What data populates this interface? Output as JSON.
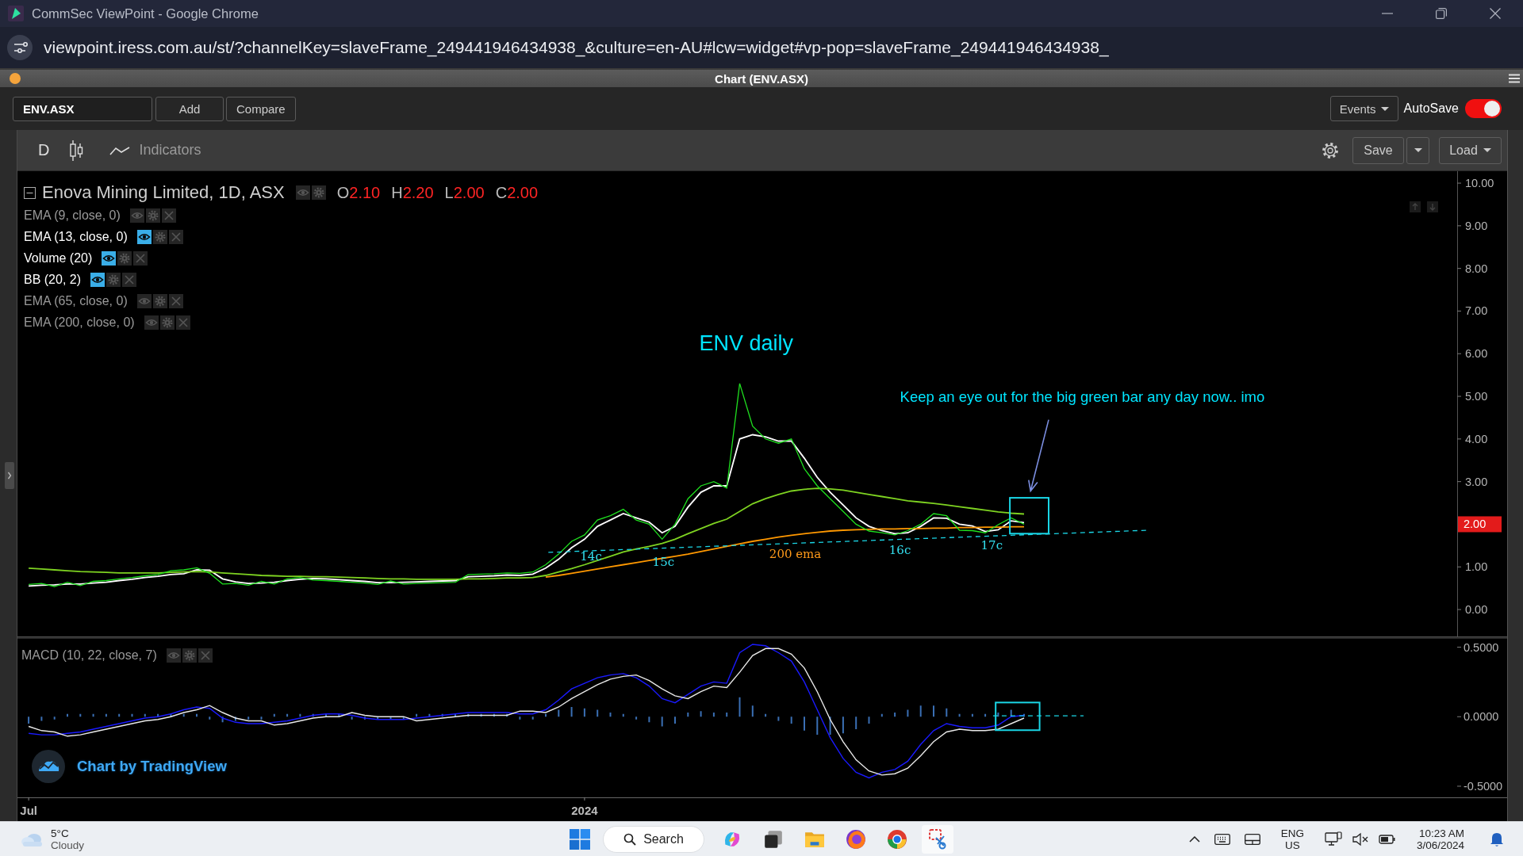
{
  "browser": {
    "title": "CommSec ViewPoint - Google Chrome",
    "url": "viewpoint.iress.com.au/st/?channelKey=slaveFrame_249441946434938_&culture=en-AU#lcw=widget#vp-pop=slaveFrame_249441946434938_"
  },
  "widget": {
    "title": "Chart (ENV.ASX)"
  },
  "toolbar": {
    "symbol": "ENV.ASX",
    "buttons": [
      "Add",
      "Compare"
    ],
    "events": "Events",
    "autosave": {
      "label": "AutoSave",
      "on": true
    }
  },
  "chart_toolbar": {
    "interval": "D",
    "indicators": "Indicators",
    "save": "Save",
    "load": "Load"
  },
  "legend": {
    "title": "Enova Mining Limited, 1D, ASX",
    "ohlc": [
      {
        "label": "O",
        "value": "2.10"
      },
      {
        "label": "H",
        "value": "2.20"
      },
      {
        "label": "L",
        "value": "2.00"
      },
      {
        "label": "C",
        "value": "2.00"
      }
    ],
    "indicators": [
      {
        "name": "EMA (9, close, 0)",
        "hidden": false
      },
      {
        "name": "EMA (13, close, 0)",
        "hidden": true
      },
      {
        "name": "Volume (20)",
        "hidden": true
      },
      {
        "name": "BB (20, 2)",
        "hidden": true
      },
      {
        "name": "EMA (65, close, 0)",
        "hidden": false
      },
      {
        "name": "EMA (200, close, 0)",
        "hidden": false
      }
    ]
  },
  "price_pane": {
    "last_price": "2.00",
    "chart_data": {
      "type": "line",
      "title": "ENV daily",
      "categories": [
        null,
        null,
        null,
        null,
        null,
        null,
        null,
        null,
        null,
        null,
        null,
        null,
        null,
        null,
        null,
        null,
        null,
        null,
        null,
        null,
        null,
        null,
        null,
        null,
        null,
        null,
        null,
        null,
        null,
        null,
        null,
        null,
        null,
        null,
        null,
        null,
        null,
        null,
        null,
        null,
        null,
        null,
        null,
        null,
        null,
        null,
        null,
        null,
        null,
        null,
        null,
        null,
        null,
        null,
        null,
        null,
        null,
        null,
        null,
        null,
        null,
        null,
        null,
        null,
        null,
        null,
        null,
        null,
        null,
        null,
        null,
        null,
        null,
        null,
        null,
        null,
        null,
        null,
        null,
        null,
        null,
        null,
        null,
        null,
        null,
        null,
        null,
        null,
        null,
        null,
        null,
        null,
        null,
        null,
        null,
        null,
        null,
        null,
        null,
        null,
        null,
        null,
        null,
        null,
        null,
        null,
        null,
        null,
        null,
        null,
        null
      ],
      "ylim": [
        -0.65,
        10.28
      ],
      "yticks": [
        {
          "value": 0,
          "label": "0.00"
        },
        {
          "value": 1,
          "label": "1.00"
        },
        {
          "value": 3,
          "label": "3.00"
        },
        {
          "value": 4,
          "label": "4.00"
        },
        {
          "value": 5,
          "label": "5.00"
        },
        {
          "value": 6,
          "label": "6.00"
        },
        {
          "value": 7,
          "label": "7.00"
        },
        {
          "value": 8,
          "label": "8.00"
        },
        {
          "value": 9,
          "label": "9.00"
        },
        {
          "value": 10,
          "label": "10.00"
        }
      ],
      "series": [
        {
          "color": "#1fe01f",
          "values": [
            0.59,
            0.61,
            0.54,
            0.64,
            0.56,
            0.66,
            0.68,
            0.72,
            0.75,
            0.79,
            0.82,
            0.91,
            0.93,
            0.98,
            0.85,
            0.6,
            0.61,
            0.57,
            0.66,
            0.6,
            0.72,
            0.75,
            0.69,
            0.68,
            0.66,
            0.64,
            0.62,
            0.59,
            0.67,
            0.6,
            0.61,
            0.62,
            0.63,
            0.64,
            0.82,
            0.83,
            0.84,
            0.86,
            0.85,
            0.88,
            1.05,
            1.3,
            1.6,
            1.75,
            2.1,
            2.2,
            2.35,
            2.1,
            2.0,
            1.65,
            2.0,
            2.6,
            2.9,
            3.0,
            2.85,
            5.3,
            4.3,
            4.0,
            3.9,
            4.0,
            3.3,
            2.9,
            2.6,
            2.3,
            2.0,
            1.84,
            1.8,
            1.75,
            1.85,
            2.0,
            2.25,
            2.2,
            1.86,
            1.85,
            1.8,
            1.99,
            2.15,
            2.0,
            null,
            null,
            null,
            null,
            null,
            null,
            null,
            null,
            null,
            null,
            null,
            null,
            null,
            null,
            null,
            null,
            null,
            null,
            null,
            null,
            null,
            null,
            null,
            null,
            null,
            null,
            null,
            null,
            null,
            null,
            null,
            null,
            null
          ]
        },
        {
          "color": "#ffffff",
          "values": [
            0.55,
            0.57,
            0.58,
            0.6,
            0.6,
            0.62,
            0.64,
            0.68,
            0.71,
            0.75,
            0.78,
            0.82,
            0.84,
            0.93,
            0.92,
            0.72,
            0.65,
            0.61,
            0.62,
            0.64,
            0.68,
            0.71,
            0.73,
            0.72,
            0.7,
            0.68,
            0.66,
            0.63,
            0.63,
            0.64,
            0.65,
            0.66,
            0.67,
            0.68,
            0.77,
            0.78,
            0.79,
            0.81,
            0.8,
            0.83,
            0.97,
            1.18,
            1.45,
            1.65,
            1.95,
            2.1,
            2.25,
            2.15,
            2.05,
            1.8,
            1.95,
            2.4,
            2.75,
            2.9,
            2.9,
            4.0,
            4.1,
            4.05,
            3.95,
            3.95,
            3.55,
            3.1,
            2.75,
            2.45,
            2.15,
            1.95,
            1.85,
            1.78,
            1.8,
            1.95,
            2.15,
            2.14,
            2.0,
            1.96,
            1.83,
            1.87,
            2.08,
            2.04,
            null,
            null,
            null,
            null,
            null,
            null,
            null,
            null,
            null,
            null,
            null,
            null,
            null,
            null,
            null,
            null,
            null,
            null,
            null,
            null,
            null,
            null,
            null,
            null,
            null,
            null,
            null,
            null,
            null,
            null,
            null,
            null,
            null
          ]
        },
        {
          "color": "#7ed321",
          "values": [
            0.97,
            0.95,
            0.93,
            0.91,
            0.89,
            0.88,
            0.87,
            0.86,
            0.86,
            0.86,
            0.86,
            0.87,
            0.88,
            0.89,
            0.88,
            0.86,
            0.84,
            0.82,
            0.8,
            0.79,
            0.78,
            0.78,
            0.77,
            0.77,
            0.76,
            0.75,
            0.74,
            0.73,
            0.72,
            0.72,
            0.71,
            0.71,
            0.71,
            0.71,
            0.72,
            0.72,
            0.73,
            0.74,
            0.74,
            0.75,
            0.8,
            0.88,
            0.96,
            1.05,
            1.15,
            1.25,
            1.35,
            1.42,
            1.48,
            1.55,
            1.65,
            1.78,
            1.9,
            2.02,
            2.12,
            2.3,
            2.48,
            2.6,
            2.7,
            2.78,
            2.82,
            2.84,
            2.83,
            2.8,
            2.75,
            2.7,
            2.65,
            2.6,
            2.55,
            2.52,
            2.49,
            2.45,
            2.41,
            2.37,
            2.33,
            2.29,
            2.26,
            2.24,
            null,
            null,
            null,
            null,
            null,
            null,
            null,
            null,
            null,
            null,
            null,
            null,
            null,
            null,
            null,
            null,
            null,
            null,
            null,
            null,
            null,
            null,
            null,
            null,
            null,
            null,
            null,
            null,
            null,
            null,
            null,
            null,
            null
          ]
        },
        {
          "color": "#ff9800",
          "values": [
            null,
            null,
            null,
            null,
            null,
            null,
            null,
            null,
            null,
            null,
            null,
            null,
            null,
            null,
            null,
            null,
            null,
            null,
            null,
            null,
            null,
            null,
            null,
            null,
            null,
            null,
            null,
            null,
            null,
            null,
            null,
            null,
            null,
            null,
            null,
            null,
            null,
            null,
            null,
            null,
            0.76,
            0.8,
            0.85,
            0.9,
            0.95,
            1.0,
            1.05,
            1.1,
            1.15,
            1.2,
            1.25,
            1.3,
            1.36,
            1.42,
            1.48,
            1.54,
            1.6,
            1.65,
            1.7,
            1.74,
            1.78,
            1.81,
            1.84,
            1.86,
            1.87,
            1.88,
            1.89,
            1.89,
            1.9,
            1.9,
            1.91,
            1.91,
            1.92,
            1.92,
            1.93,
            1.93,
            1.94,
            1.94,
            null,
            null,
            null,
            null,
            null,
            null,
            null,
            null,
            null,
            null,
            null,
            null,
            null,
            null,
            null,
            null,
            null,
            null,
            null,
            null,
            null,
            null,
            null,
            null,
            null,
            null,
            null,
            null,
            null,
            null,
            null,
            null,
            null
          ]
        }
      ],
      "annotations": [
        "Keep an eye out for the big green bar any day now.. imo",
        "14c",
        "15c",
        "200 ema",
        "16c",
        "17c"
      ]
    }
  },
  "macd_pane": {
    "legend": {
      "name": "MACD (10, 22, close, 7)",
      "hidden": false
    },
    "chart_data": {
      "type": "line",
      "categories": [
        "Jul",
        null,
        null,
        null,
        null,
        null,
        null,
        null,
        null,
        null,
        null,
        null,
        null,
        null,
        null,
        null,
        null,
        null,
        null,
        null,
        null,
        null,
        null,
        null,
        null,
        null,
        null,
        null,
        null,
        null,
        null,
        null,
        null,
        null,
        null,
        null,
        null,
        null,
        null,
        null,
        null,
        null,
        null,
        "2024",
        null,
        null,
        null,
        null,
        null,
        null,
        null,
        null,
        null,
        null,
        null,
        null,
        null,
        null,
        null,
        null,
        null,
        null,
        null,
        null,
        null,
        null,
        null,
        null,
        null,
        null,
        null,
        null,
        null,
        null,
        null,
        null,
        null,
        null,
        null,
        null,
        null,
        null,
        null,
        null,
        null,
        null,
        null,
        null,
        null,
        null,
        null,
        null,
        null,
        null,
        null,
        null,
        null,
        null,
        null,
        null,
        null,
        null,
        null,
        null,
        null,
        null,
        null,
        null,
        null,
        null,
        null
      ],
      "ylim": [
        -0.58,
        0.56
      ],
      "yticks": [
        {
          "value": -0.5,
          "label": "-0.5000"
        },
        {
          "value": 0,
          "label": "0.0000"
        },
        {
          "value": 0.5,
          "label": "0.5000"
        }
      ],
      "series": [
        {
          "color": "#1a1aff",
          "values": [
            -0.12,
            -0.13,
            -0.13,
            -0.12,
            -0.11,
            -0.09,
            -0.07,
            -0.05,
            -0.03,
            -0.01,
            0.0,
            0.02,
            0.05,
            0.07,
            0.06,
            -0.01,
            -0.04,
            -0.05,
            -0.05,
            -0.04,
            -0.03,
            -0.01,
            0.01,
            0.02,
            0.02,
            0.01,
            -0.01,
            -0.02,
            -0.02,
            -0.02,
            -0.01,
            0.0,
            0.01,
            0.02,
            0.03,
            0.03,
            0.03,
            0.03,
            0.02,
            0.02,
            0.05,
            0.12,
            0.2,
            0.24,
            0.28,
            0.3,
            0.31,
            0.28,
            0.22,
            0.13,
            0.1,
            0.16,
            0.22,
            0.25,
            0.24,
            0.46,
            0.52,
            0.51,
            0.46,
            0.4,
            0.25,
            0.05,
            -0.15,
            -0.3,
            -0.4,
            -0.44,
            -0.4,
            -0.38,
            -0.32,
            -0.2,
            -0.1,
            -0.05,
            -0.07,
            -0.08,
            -0.08,
            -0.06,
            0.0,
            0.01,
            null,
            null,
            null,
            null,
            null,
            null,
            null,
            null,
            null,
            null,
            null,
            null,
            null,
            null,
            null,
            null,
            null,
            null,
            null,
            null,
            null,
            null,
            null,
            null,
            null,
            null,
            null,
            null,
            null,
            null,
            null,
            null,
            null
          ]
        },
        {
          "color": "#e8e8e8",
          "values": [
            -0.07,
            -0.1,
            -0.11,
            -0.14,
            -0.13,
            -0.11,
            -0.09,
            -0.07,
            -0.05,
            -0.03,
            -0.02,
            0.0,
            0.03,
            0.05,
            0.08,
            0.03,
            -0.01,
            -0.03,
            -0.03,
            -0.06,
            -0.05,
            -0.03,
            -0.01,
            0.0,
            0.0,
            0.03,
            0.01,
            0.0,
            0.0,
            0.0,
            -0.03,
            -0.02,
            -0.01,
            0.0,
            0.01,
            0.01,
            0.01,
            0.01,
            0.04,
            0.04,
            0.03,
            0.07,
            0.13,
            0.18,
            0.23,
            0.27,
            0.29,
            0.3,
            0.26,
            0.2,
            0.15,
            0.13,
            0.18,
            0.22,
            0.21,
            0.32,
            0.44,
            0.49,
            0.49,
            0.45,
            0.35,
            0.18,
            -0.02,
            -0.18,
            -0.31,
            -0.39,
            -0.42,
            -0.41,
            -0.37,
            -0.28,
            -0.18,
            -0.11,
            -0.09,
            -0.1,
            -0.1,
            -0.09,
            -0.05,
            -0.01,
            null,
            null,
            null,
            null,
            null,
            null,
            null,
            null,
            null,
            null,
            null,
            null,
            null,
            null,
            null,
            null,
            null,
            null,
            null,
            null,
            null,
            null,
            null,
            null,
            null,
            null,
            null,
            null,
            null,
            null,
            null,
            null,
            null
          ]
        }
      ]
    }
  },
  "attribution": "Chart by TradingView",
  "taskbar": {
    "weather": {
      "temperature": "5°C",
      "condition": "Cloudy"
    },
    "search": "Search",
    "language": {
      "input": "ENG",
      "region": "US"
    },
    "clock": {
      "time": "10:23 AM",
      "date": "3/06/2024"
    }
  }
}
